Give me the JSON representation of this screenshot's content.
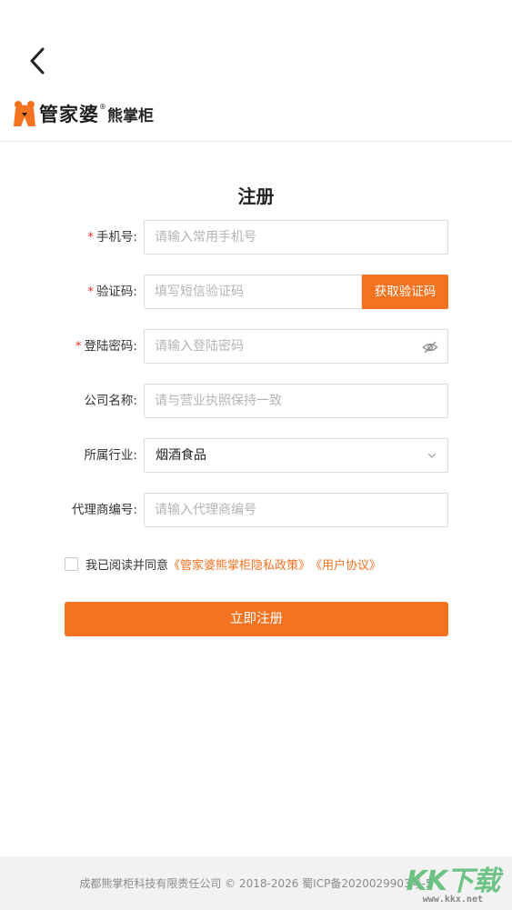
{
  "logo": {
    "brand": "管家婆",
    "mark": "®",
    "product": "熊掌柜"
  },
  "page": {
    "title": "注册"
  },
  "form": {
    "required_mark": "*",
    "phone": {
      "label": "手机号:",
      "placeholder": "请输入常用手机号"
    },
    "code": {
      "label": "验证码:",
      "placeholder": "填写短信验证码",
      "button": "获取验证码"
    },
    "password": {
      "label": "登陆密码:",
      "placeholder": "请输入登陆密码"
    },
    "company": {
      "label": "公司名称:",
      "placeholder": "请与营业执照保持一致"
    },
    "industry": {
      "label": "所属行业:",
      "value": "烟酒食品"
    },
    "agent": {
      "label": "代理商编号:",
      "placeholder": "请输入代理商编号"
    }
  },
  "agreement": {
    "text": "我已阅读并同意",
    "privacy_link": "《管家婆熊掌柜隐私政策》",
    "user_link": "《用户协议》"
  },
  "submit_label": "立即注册",
  "footer": {
    "copyright": "成都熊掌柜科技有限责任公司 © 2018-2026 蜀ICP备2020029903号-5"
  },
  "watermark": {
    "main": "KK下载",
    "sub": "www.kkx.net"
  },
  "colors": {
    "accent": "#f47321",
    "required": "#e8352a"
  }
}
